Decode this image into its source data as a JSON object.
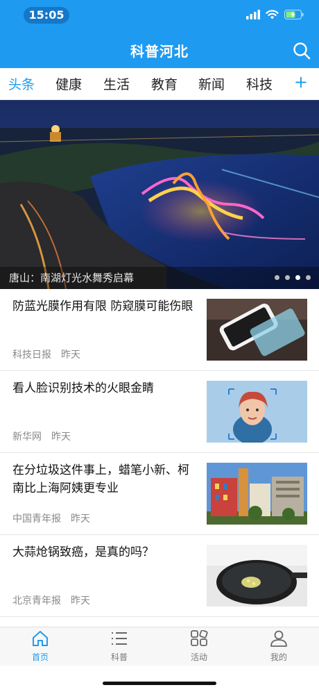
{
  "status_bar": {
    "time": "15:05"
  },
  "header": {
    "title": "科普河北",
    "accent": "#1e9bf0"
  },
  "tabs": [
    {
      "label": "头条",
      "active": true
    },
    {
      "label": "健康",
      "active": false
    },
    {
      "label": "生活",
      "active": false
    },
    {
      "label": "教育",
      "active": false
    },
    {
      "label": "新闻",
      "active": false
    },
    {
      "label": "科技",
      "active": false
    }
  ],
  "tabs_more": "+",
  "hero": {
    "caption": "唐山：南湖灯光水舞秀启幕",
    "slides": 4,
    "active_slide": 3
  },
  "news": [
    {
      "title": "防蓝光膜作用有限 防窥膜可能伤眼",
      "source": "科技日报",
      "time": "昨天",
      "thumb": "phone-screen-protector"
    },
    {
      "title": "看人脸识别技术的火眼金睛",
      "source": "新华网",
      "time": "昨天",
      "thumb": "face-recognition"
    },
    {
      "title": "在分垃圾这件事上，蜡笔小新、柯南比上海阿姨更专业",
      "source": "中国青年报",
      "time": "昨天",
      "thumb": "colorful-buildings"
    },
    {
      "title": "大蒜炝锅致癌，是真的吗？",
      "source": "北京青年报",
      "time": "昨天",
      "thumb": "frying-pan"
    }
  ],
  "bottom_nav": [
    {
      "label": "首页",
      "icon": "home-icon",
      "active": true
    },
    {
      "label": "科普",
      "icon": "list-icon",
      "active": false
    },
    {
      "label": "活动",
      "icon": "grid-icon",
      "active": false
    },
    {
      "label": "我的",
      "icon": "person-icon",
      "active": false
    }
  ]
}
